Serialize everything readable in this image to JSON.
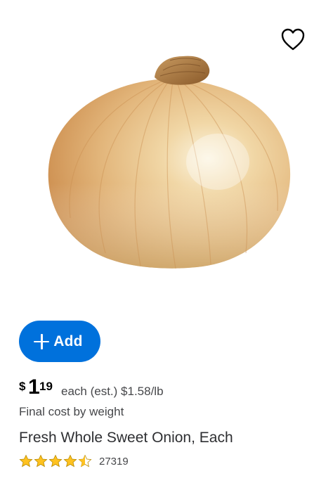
{
  "product": {
    "image_alt": "Yellow sweet onion",
    "favorite_icon": "heart-outline-icon",
    "add_button": {
      "icon": "plus-icon",
      "label": "Add",
      "color": "#0071dc"
    },
    "price": {
      "currency": "$",
      "dollars": "1",
      "cents": "19",
      "unit_text": "each (est.) $1.58/lb"
    },
    "final_cost_note": "Final cost by weight",
    "title": "Fresh Whole Sweet Onion, Each",
    "rating": {
      "stars": 4.5,
      "star_color": "#ffc220",
      "review_count": "27319"
    }
  }
}
